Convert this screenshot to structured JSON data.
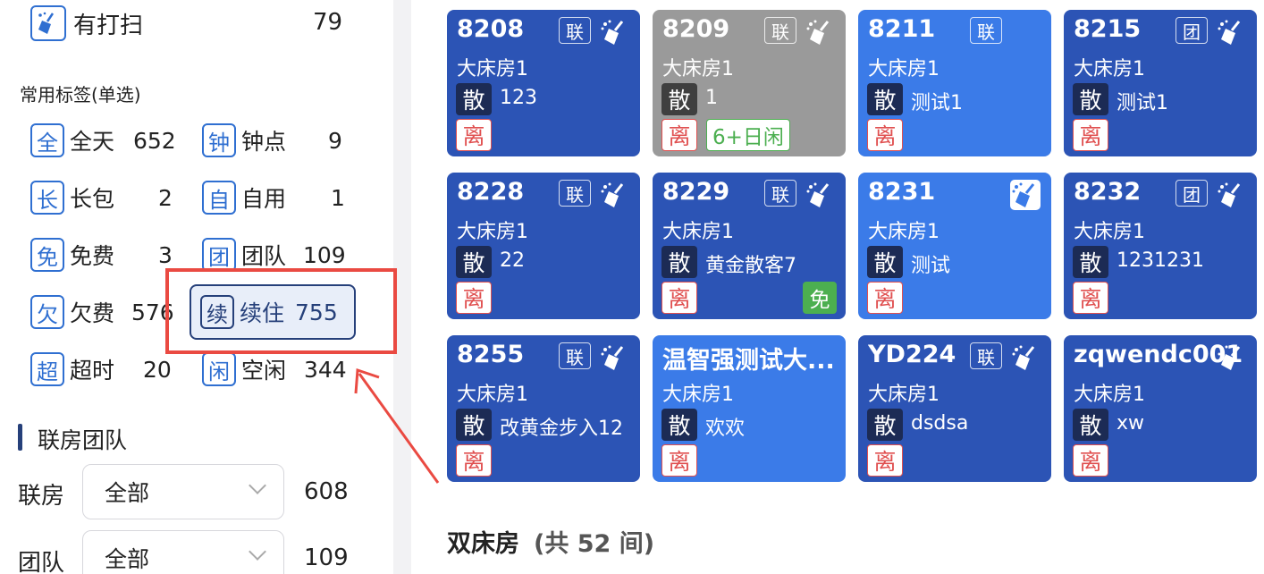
{
  "sidebar": {
    "clean_row": {
      "label": "有打扫",
      "count": "79"
    },
    "tags_heading": "常用标签(单选)",
    "tags": [
      {
        "icon": "全",
        "label": "全天",
        "count": "652"
      },
      {
        "icon": "钟",
        "label": "钟点",
        "count": "9"
      },
      {
        "icon": "长",
        "label": "长包",
        "count": "2"
      },
      {
        "icon": "自",
        "label": "自用",
        "count": "1"
      },
      {
        "icon": "免",
        "label": "免费",
        "count": "3"
      },
      {
        "icon": "团",
        "label": "团队",
        "count": "109"
      },
      {
        "icon": "欠",
        "label": "欠费",
        "count": "576"
      },
      {
        "icon": "续",
        "label": "续住",
        "count": "755"
      },
      {
        "icon": "超",
        "label": "超时",
        "count": "20"
      },
      {
        "icon": "闲",
        "label": "空闲",
        "count": "344"
      }
    ],
    "group_heading": "联房团队",
    "filters": [
      {
        "label": "联房",
        "value": "全部",
        "count": "608"
      },
      {
        "label": "团队",
        "value": "全部",
        "count": "109"
      }
    ]
  },
  "rooms": [
    {
      "number": "8208",
      "type": "大床房1",
      "san": "散",
      "guest": "123",
      "li": "离",
      "badge": "联",
      "style": "blue",
      "broom": "plain"
    },
    {
      "number": "8209",
      "type": "大床房1",
      "san": "散",
      "guest": "1",
      "li": "离",
      "badge": "联",
      "style": "grey",
      "broom": "plain",
      "idle": "6+日闲"
    },
    {
      "number": "8211",
      "type": "大床房1",
      "san": "散",
      "guest": "测试1",
      "li": "离",
      "badge": "联",
      "style": "light",
      "broom": "none"
    },
    {
      "number": "8215",
      "type": "大床房1",
      "san": "散",
      "guest": "测试1",
      "li": "离",
      "badge": "团",
      "style": "blue",
      "broom": "plain"
    },
    {
      "number": "8228",
      "type": "大床房1",
      "san": "散",
      "guest": "22",
      "li": "离",
      "badge": "联",
      "style": "blue",
      "broom": "plain"
    },
    {
      "number": "8229",
      "type": "大床房1",
      "san": "散",
      "guest": "黄金散客7",
      "li": "离",
      "badge": "联",
      "style": "blue",
      "broom": "plain",
      "free": "免"
    },
    {
      "number": "8231",
      "type": "大床房1",
      "san": "散",
      "guest": "测试",
      "li": "离",
      "badge": "",
      "style": "light",
      "broom": "boxed"
    },
    {
      "number": "8232",
      "type": "大床房1",
      "san": "散",
      "guest": "1231231",
      "li": "离",
      "badge": "团",
      "style": "blue",
      "broom": "plain"
    },
    {
      "number": "8255",
      "type": "大床房1",
      "san": "散",
      "guest": "改黄金步入12",
      "li": "离",
      "badge": "联",
      "style": "blue",
      "broom": "plain"
    },
    {
      "number": "温智强测试大...",
      "type": "大床房1",
      "san": "散",
      "guest": "欢欢",
      "li": "离",
      "badge": "",
      "style": "light",
      "broom": "none"
    },
    {
      "number": "YD224",
      "type": "大床房1",
      "san": "散",
      "guest": "dsdsa",
      "li": "离",
      "badge": "联",
      "style": "blue",
      "broom": "plain"
    },
    {
      "number": "zqwendc001",
      "type": "大床房1",
      "san": "散",
      "guest": "xw",
      "li": "离",
      "badge": "",
      "style": "blue",
      "broom": "plain"
    }
  ],
  "next_section": {
    "title": "双床房",
    "count": "(共 52 间)"
  },
  "colors": {
    "accent": "#2f6fd1",
    "highlight": "#ea4a42",
    "card_blue": "#2c54b5",
    "card_grey": "#9a9a9a",
    "card_light": "#3b7be8"
  }
}
